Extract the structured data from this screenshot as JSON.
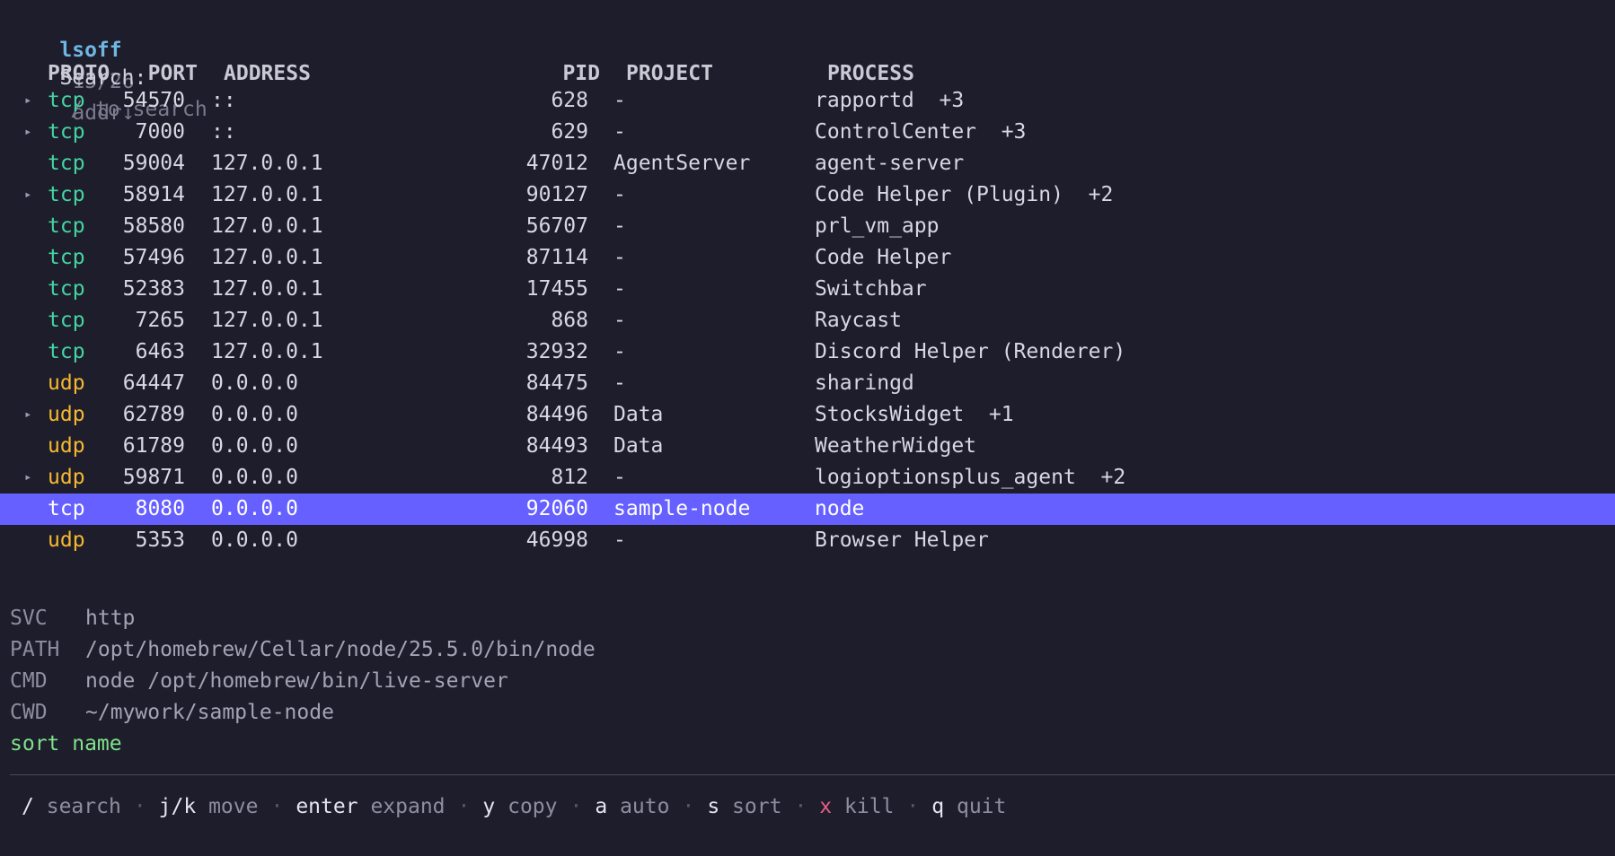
{
  "header": {
    "title": "lsoff",
    "count": "15/26",
    "sort_indicator": "addr↓"
  },
  "search": {
    "label": "Search:",
    "placeholder": "/ to search"
  },
  "columns": {
    "proto": "PROTO",
    "port": "PORT",
    "address": "ADDRESS",
    "pid": "PID",
    "project": "PROJECT",
    "process": "PROCESS"
  },
  "rows": [
    {
      "expand": "▸",
      "proto": "tcp",
      "port": "54570",
      "address": "::",
      "pid": "628",
      "project": "-",
      "process": "rapportd  +3",
      "selected": false
    },
    {
      "expand": "▸",
      "proto": "tcp",
      "port": "7000",
      "address": "::",
      "pid": "629",
      "project": "-",
      "process": "ControlCenter  +3",
      "selected": false
    },
    {
      "expand": "",
      "proto": "tcp",
      "port": "59004",
      "address": "127.0.0.1",
      "pid": "47012",
      "project": "AgentServer",
      "process": "agent-server",
      "selected": false
    },
    {
      "expand": "▸",
      "proto": "tcp",
      "port": "58914",
      "address": "127.0.0.1",
      "pid": "90127",
      "project": "-",
      "process": "Code Helper (Plugin)  +2",
      "selected": false
    },
    {
      "expand": "",
      "proto": "tcp",
      "port": "58580",
      "address": "127.0.0.1",
      "pid": "56707",
      "project": "-",
      "process": "prl_vm_app",
      "selected": false
    },
    {
      "expand": "",
      "proto": "tcp",
      "port": "57496",
      "address": "127.0.0.1",
      "pid": "87114",
      "project": "-",
      "process": "Code Helper",
      "selected": false
    },
    {
      "expand": "",
      "proto": "tcp",
      "port": "52383",
      "address": "127.0.0.1",
      "pid": "17455",
      "project": "-",
      "process": "Switchbar",
      "selected": false
    },
    {
      "expand": "",
      "proto": "tcp",
      "port": "7265",
      "address": "127.0.0.1",
      "pid": "868",
      "project": "-",
      "process": "Raycast",
      "selected": false
    },
    {
      "expand": "",
      "proto": "tcp",
      "port": "6463",
      "address": "127.0.0.1",
      "pid": "32932",
      "project": "-",
      "process": "Discord Helper (Renderer)",
      "selected": false
    },
    {
      "expand": "",
      "proto": "udp",
      "port": "64447",
      "address": "0.0.0.0",
      "pid": "84475",
      "project": "-",
      "process": "sharingd",
      "selected": false
    },
    {
      "expand": "▸",
      "proto": "udp",
      "port": "62789",
      "address": "0.0.0.0",
      "pid": "84496",
      "project": "Data",
      "process": "StocksWidget  +1",
      "selected": false
    },
    {
      "expand": "",
      "proto": "udp",
      "port": "61789",
      "address": "0.0.0.0",
      "pid": "84493",
      "project": "Data",
      "process": "WeatherWidget",
      "selected": false
    },
    {
      "expand": "▸",
      "proto": "udp",
      "port": "59871",
      "address": "0.0.0.0",
      "pid": "812",
      "project": "-",
      "process": "logioptionsplus_agent  +2",
      "selected": false
    },
    {
      "expand": "",
      "proto": "tcp",
      "port": "8080",
      "address": "0.0.0.0",
      "pid": "92060",
      "project": "sample-node",
      "process": "node",
      "selected": true
    },
    {
      "expand": "",
      "proto": "udp",
      "port": "5353",
      "address": "0.0.0.0",
      "pid": "46998",
      "project": "-",
      "process": "Browser Helper",
      "selected": false
    }
  ],
  "details": [
    {
      "key": "SVC",
      "value": "http"
    },
    {
      "key": "PATH",
      "value": "/opt/homebrew/Cellar/node/25.5.0/bin/node"
    },
    {
      "key": "CMD",
      "value": "node /opt/homebrew/bin/live-server"
    },
    {
      "key": "CWD",
      "value": "~/mywork/sample-node"
    }
  ],
  "status": "sort name",
  "help": {
    "separator": "·",
    "items": [
      {
        "key": "/",
        "desc": "search",
        "danger": false
      },
      {
        "key": "j/k",
        "desc": "move",
        "danger": false
      },
      {
        "key": "enter",
        "desc": "expand",
        "danger": false
      },
      {
        "key": "y",
        "desc": "copy",
        "danger": false
      },
      {
        "key": "a",
        "desc": "auto",
        "danger": false
      },
      {
        "key": "s",
        "desc": "sort",
        "danger": false
      },
      {
        "key": "x",
        "desc": "kill",
        "danger": true
      },
      {
        "key": "q",
        "desc": "quit",
        "danger": false
      }
    ]
  },
  "colors": {
    "background": "#1e1d2b",
    "selection": "#6560ff",
    "tcp": "#43d6a1",
    "udp": "#f6b830",
    "title": "#6fb7e2",
    "status": "#7ee38a",
    "danger": "#e85c88"
  }
}
